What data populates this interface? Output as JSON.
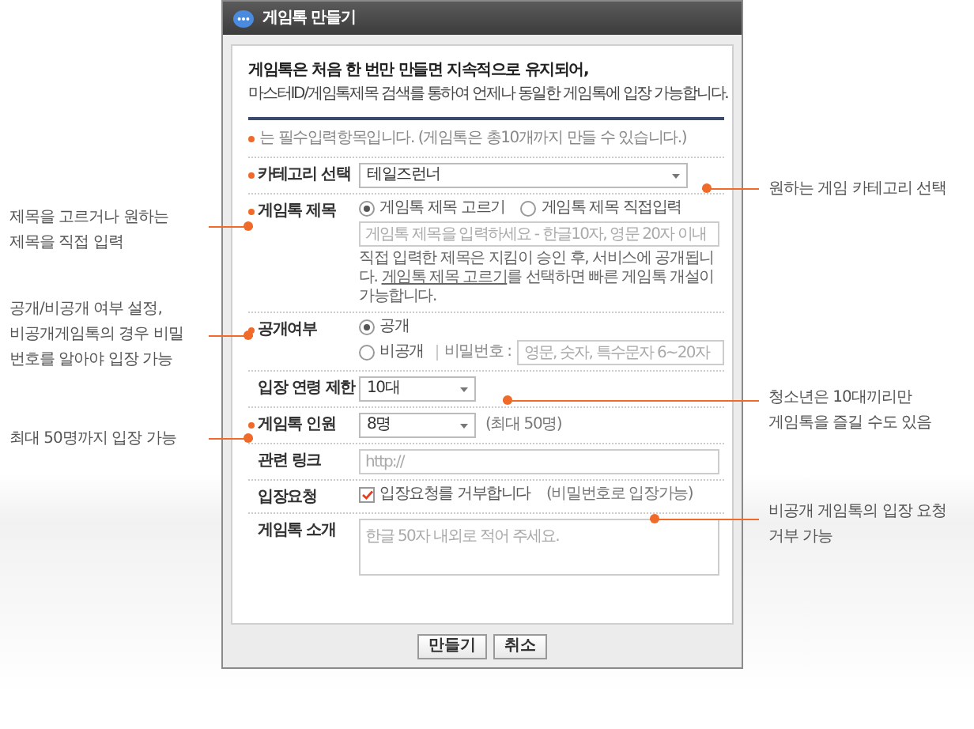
{
  "window": {
    "title": "게임톡 만들기"
  },
  "intro": {
    "headline": "게임톡은 처음 한 번만 만들면 지속적으로 유지되어,",
    "text": "마스터ID/게임톡제목 검색를 통하여 언제나 동일한 게임톡에 입장 가능합니다."
  },
  "required_note": "는 필수입력항목입니다. (게임톡은 총10개까지 만들 수 있습니다.)",
  "rows": [
    {
      "kind": "select",
      "label": "카테고리 선택",
      "required": true,
      "value": "테일즈런너"
    },
    {
      "kind": "title",
      "label": "게임톡 제목",
      "required": true,
      "options": [
        {
          "label": "게임톡 제목 고르기",
          "selected": true
        },
        {
          "label": "게임톡 제목 직접입력",
          "selected": false
        }
      ],
      "placeholder": "게임톡 제목을 입력하세요 - 한글10자, 영문 20자 이내",
      "note": "직접 입력한 제목은 지킴이 승인 후, 서비스에 공개됩니다.",
      "note_link": "게임톡 제목 고르기",
      "note_rest": "를 선택하면 빠른 게임톡 개설이 가능합니다."
    },
    {
      "kind": "open",
      "label": "공개여부",
      "required": true,
      "options": [
        {
          "label": "공개",
          "selected": true
        },
        {
          "label": "비공개",
          "selected": false
        }
      ],
      "password_label": "비밀번호 :",
      "placeholder": "영문, 숫자, 특수문자 6~20자"
    },
    {
      "kind": "select",
      "label": "입장 연령 제한",
      "required": false,
      "value": "10대"
    },
    {
      "kind": "select",
      "label": "게임톡 인원",
      "required": true,
      "value": "8명",
      "hint": "(최대 50명)"
    },
    {
      "kind": "input",
      "label": "관련 링크",
      "required": false,
      "placeholder": "http://"
    },
    {
      "kind": "checkbox",
      "label": "입장요청",
      "required": false,
      "checked": true,
      "text": "입장요청를 거부합니다",
      "hint": "(비밀번호로 입장가능)"
    },
    {
      "kind": "textarea",
      "label": "게임톡 소개",
      "required": false,
      "placeholder": "한글 50자 내외로 적어 주세요."
    }
  ],
  "buttons": [
    "만들기",
    "취소"
  ],
  "annotations": [
    {
      "lines": [
        "원하는 게임 카테고리 선택"
      ]
    },
    {
      "lines": [
        "제목을 고르거나 원하는",
        "제목을 직접 입력"
      ]
    },
    {
      "lines": [
        "공개/비공개 여부 설정,",
        "비공개게임톡의 경우 비밀",
        "번호를 알아야 입장 가능"
      ]
    },
    {
      "lines": [
        "청소년은 10대끼리만",
        "게임톡을 즐길 수도 있음"
      ]
    },
    {
      "lines": [
        "최대 50명까지 입장 가능"
      ]
    },
    {
      "lines": [
        "비공개 게임톡의 입장 요청",
        "거부 가능"
      ]
    }
  ]
}
